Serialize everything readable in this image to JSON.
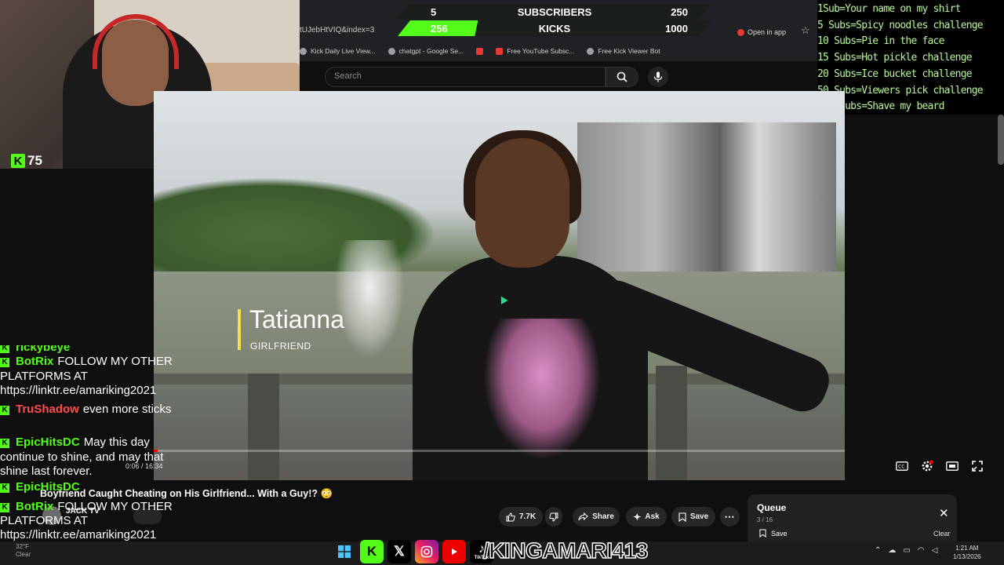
{
  "goal_bar": {
    "subscribers": {
      "current": "5",
      "label": "SUBSCRIBERS",
      "target": "250"
    },
    "kicks": {
      "current": "256",
      "label": "KICKS",
      "target": "1000",
      "progress": 0.256
    },
    "colors": {
      "kick_green": "#53fc18",
      "bar_bg": "#1b1f1c"
    }
  },
  "webcam": {
    "kick_count": "75"
  },
  "browser": {
    "url_fragment": "tUJebHtVIQ&index=3",
    "open_in_app": "Open in app",
    "bookmarks": [
      {
        "label": "Kick Daily Live View..."
      },
      {
        "label": "chatgpt - Google Se..."
      },
      {
        "label": ""
      },
      {
        "label": "Free YouTube Subsc..."
      },
      {
        "label": "Free Kick Viewer Bot"
      }
    ],
    "search_placeholder": "Search"
  },
  "goals_list": [
    "1Sub=Your name on my shirt",
    "5 Subs=Spicy noodles challenge",
    "10 Subs=Pie in the face",
    "15 Subs=Hot pickle challenge",
    "20 Subs=Ice bucket challenge",
    "50 Subs=Viewers pick challenge",
    "100 Subs=Shave my beard"
  ],
  "video": {
    "lower_third_name": "Tatianna",
    "lower_third_role": "GIRLFRIEND",
    "time": "0:06 / 16:34",
    "progress": 0.006,
    "title": "Boyfriend Caught Cheating on His Girlfriend... With a Guy!? 😳",
    "channel": "JACK TV",
    "likes": "7.7K",
    "share_label": "Share",
    "ask_label": "Ask",
    "save_label": "Save"
  },
  "chat": [
    {
      "user": "rickybeye",
      "color": "#53fc18",
      "text": ""
    },
    {
      "user": "BotRix",
      "color": "#53fc18",
      "text": "FOLLOW MY OTHER PLATFORMS AT https://linktr.ee/amariking2021"
    },
    {
      "user": "TruShadow",
      "color": "#ff4d4d",
      "text": "even more sticks"
    },
    {
      "user": "EpicHitsDC",
      "color": "#53fc18",
      "text": "May this day continue to shine, and may that shine last forever."
    },
    {
      "user": "EpicHitsDC",
      "color": "#53fc18",
      "text": ""
    },
    {
      "user": "BotRix",
      "color": "#53fc18",
      "text": "FOLLOW MY OTHER PLATFORMS AT https://linktr.ee/amariking2021"
    }
  ],
  "queue": {
    "title": "Queue",
    "count": "3 / 16",
    "save": "Save",
    "clear": "Clear"
  },
  "taskbar": {
    "handle": "/KINGAMARI413",
    "tiktok_label": "TikTok",
    "time": "1:21 AM",
    "date": "1/13/2026",
    "weather_temp": "32°F",
    "weather_text": "Clear"
  }
}
